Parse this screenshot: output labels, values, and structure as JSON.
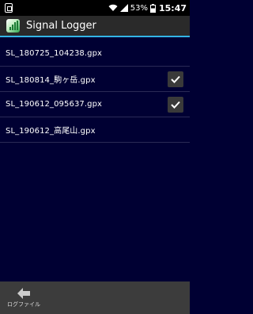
{
  "status_bar": {
    "battery_percent": "53%",
    "time": "15:47",
    "icons": [
      "notification-icon",
      "wifi-icon",
      "signal-icon",
      "battery-icon"
    ]
  },
  "app_bar": {
    "title": "Signal Logger",
    "logo_icon": "signal-logger-logo-icon",
    "accent_color": "#33b5e5"
  },
  "files": [
    {
      "name": "SL_180725_104238.gpx",
      "checked": false
    },
    {
      "name": "SL_180814_駒ヶ岳.gpx",
      "checked": true
    },
    {
      "name": "SL_190612_095637.gpx",
      "checked": true
    },
    {
      "name": "SL_190612_高尾山.gpx",
      "checked": false
    }
  ],
  "bottom_bar": {
    "log_file_label": "ログファイル",
    "log_file_icon": "arrow-left-icon"
  },
  "colors": {
    "background": "#000033",
    "app_bar": "#2a2a2a",
    "bottom_bar": "#3c3c3c"
  }
}
